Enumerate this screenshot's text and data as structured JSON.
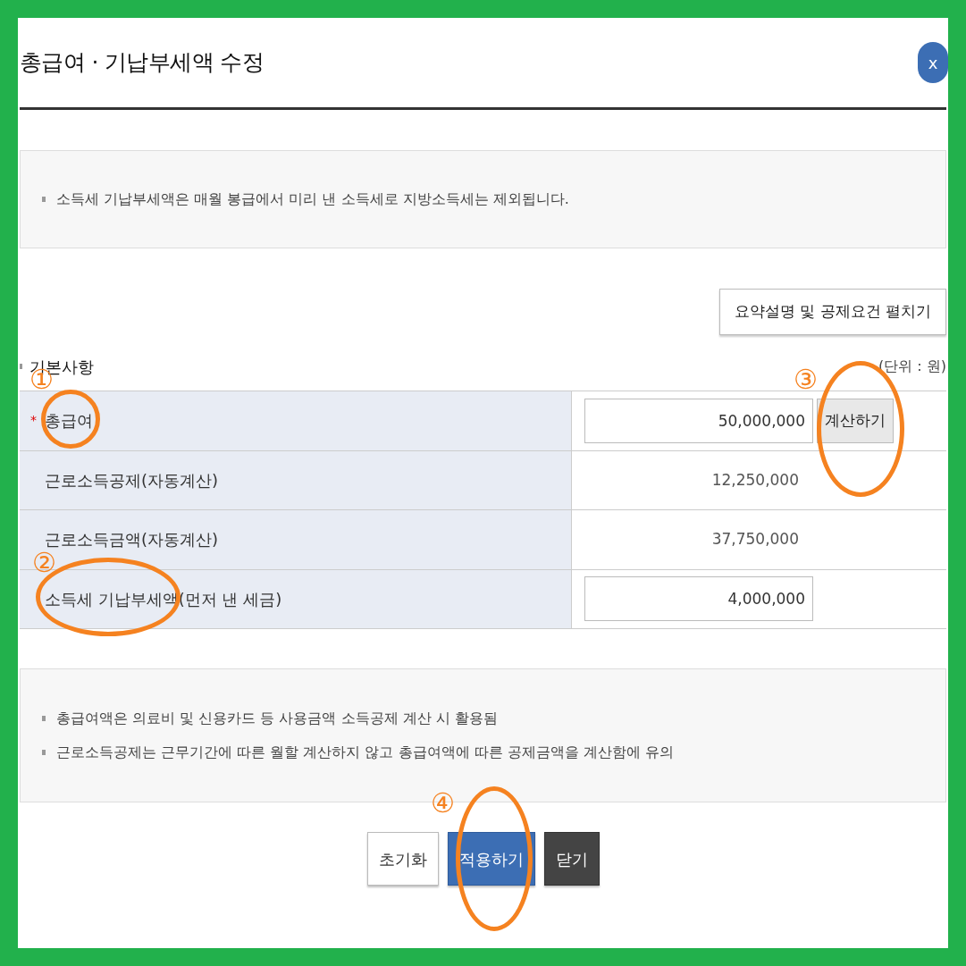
{
  "window": {
    "title": "총급여 · 기납부세액 수정",
    "close_label": "x"
  },
  "notice": [
    "소득세 기납부세액은 매월 봉급에서 미리 낸 소득세로 지방소득세는 제외됩니다."
  ],
  "expand_button": "요약설명 및 공제요건 펼치기",
  "section": {
    "title": "기본사항",
    "unit": "(단위 : 원)"
  },
  "rows": [
    {
      "label": "총급여",
      "required_mark": "*",
      "kind": "input",
      "value": "50,000,000",
      "button": "계산하기"
    },
    {
      "label": "근로소득공제(자동계산)",
      "kind": "text",
      "value": "12,250,000"
    },
    {
      "label": "근로소득금액(자동계산)",
      "kind": "text",
      "value": "37,750,000"
    },
    {
      "label": "소득세 기납부세액(먼저 낸 세금)",
      "kind": "input",
      "value": "4,000,000"
    }
  ],
  "notes": [
    "총급여액은 의료비 및 신용카드 등 사용금액 소득공제 계산 시 활용됨",
    "근로소득공제는 근무기간에 따른 월할 계산하지 않고 총급여액에 따른 공제금액을 계산함에 유의"
  ],
  "buttons": [
    {
      "label": "초기화",
      "kind": "reset"
    },
    {
      "label": "적용하기",
      "kind": "primary"
    },
    {
      "label": "닫기",
      "kind": "dark"
    }
  ],
  "annotations": [
    {
      "label": "①"
    },
    {
      "label": "②"
    },
    {
      "label": "③"
    },
    {
      "label": "④"
    }
  ]
}
